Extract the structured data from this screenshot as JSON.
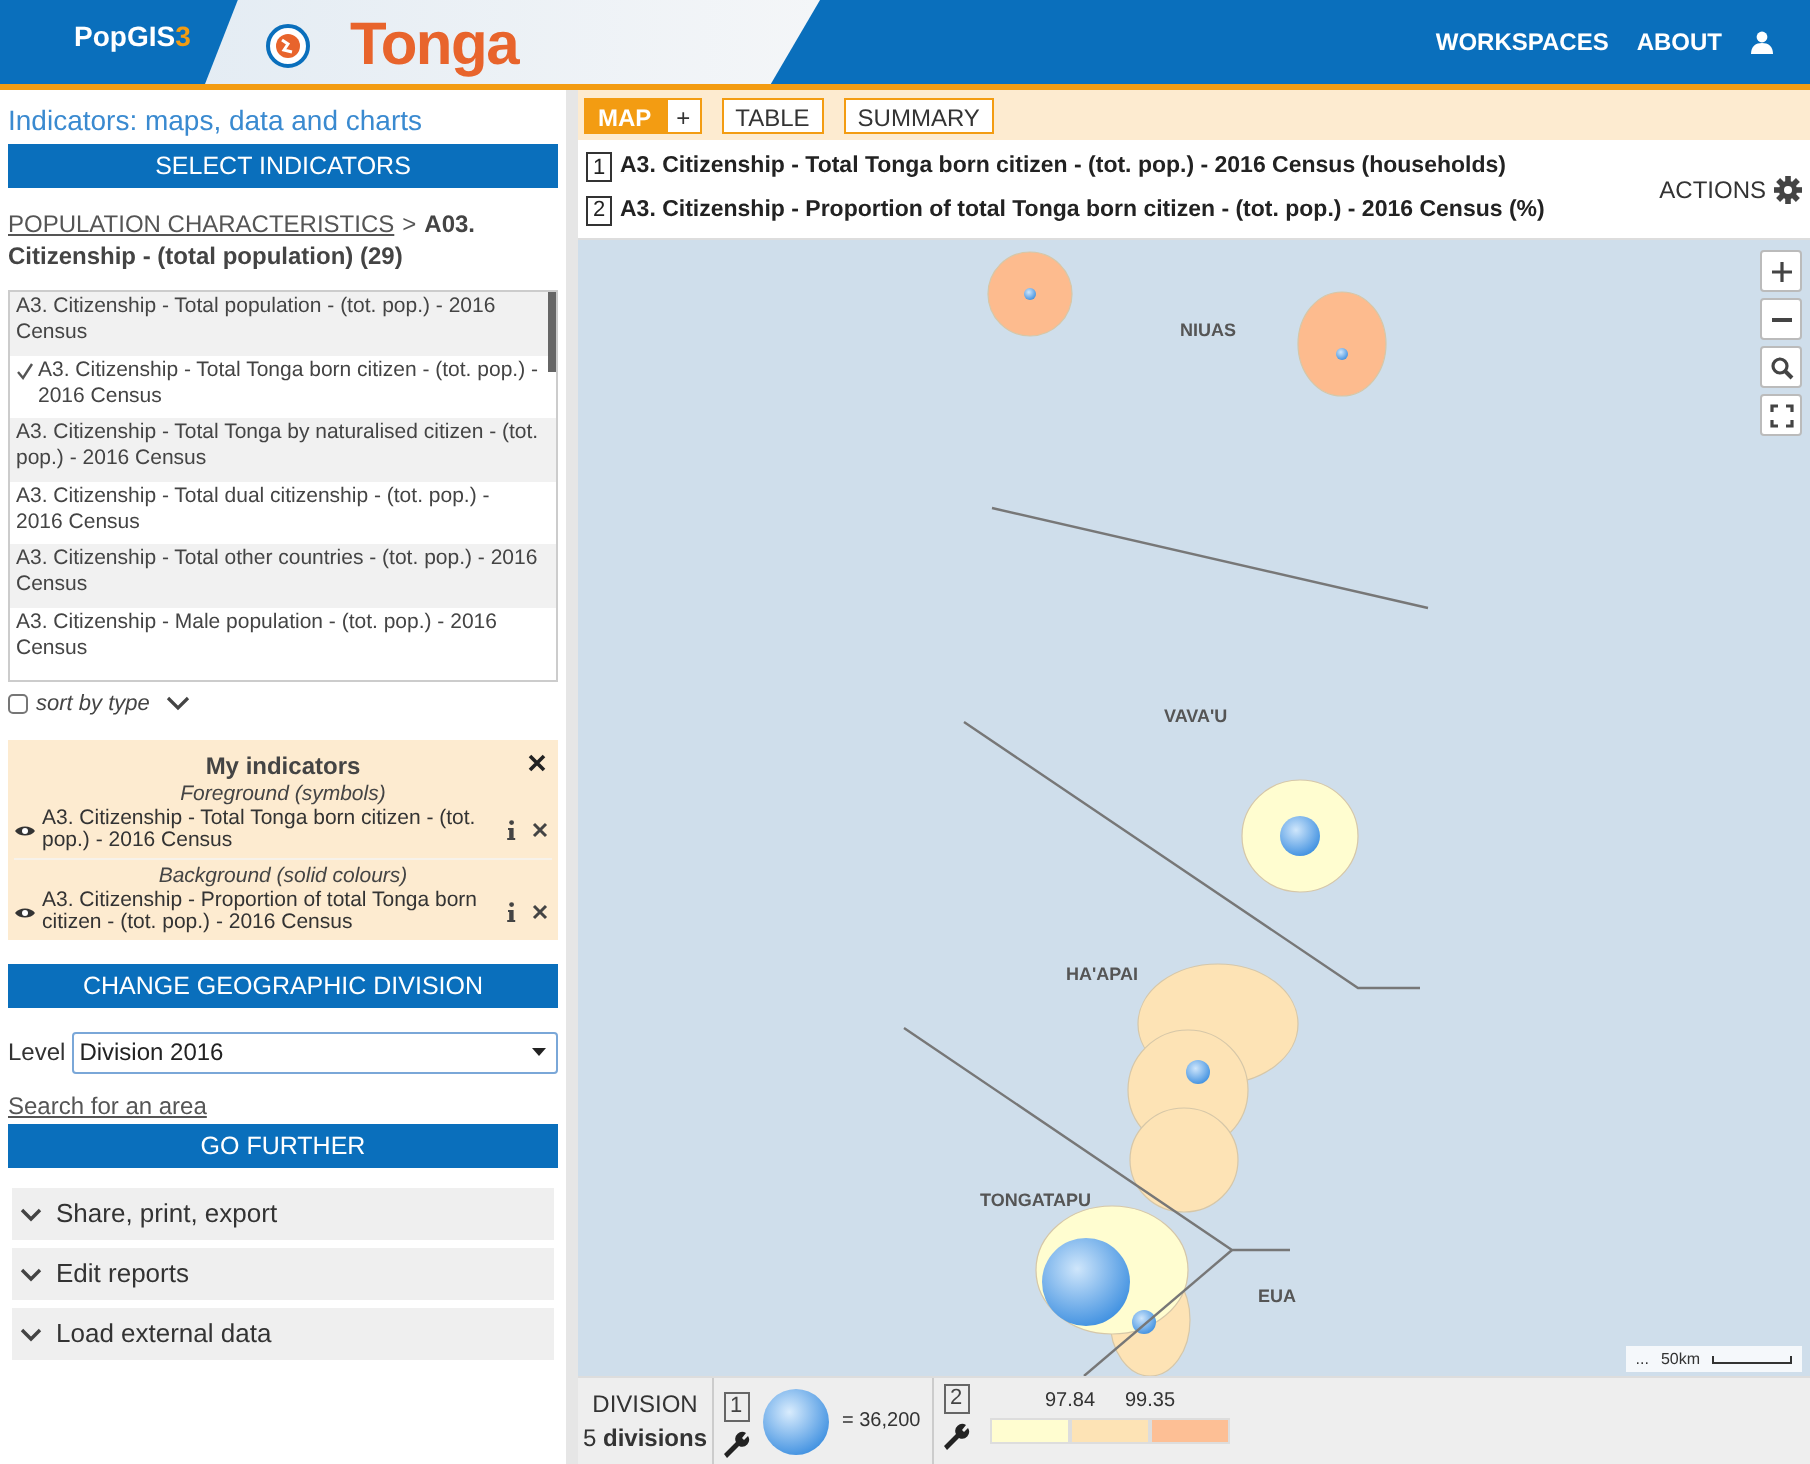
{
  "header": {
    "logo": "PopGIS",
    "logo_sup": "3",
    "country": "Tonga",
    "nav": [
      "WORKSPACES",
      "ABOUT"
    ]
  },
  "sidebar": {
    "title": "Indicators: maps, data and charts",
    "select_button": "SELECT INDICATORS",
    "breadcrumb": {
      "link": "POPULATION CHARACTERISTICS",
      "separator": ">",
      "current": "A03. Citizenship - (total population) (29)"
    },
    "indicators": [
      {
        "label": "A3. Citizenship - Total population - (tot. pop.) - 2016 Census",
        "selected": false
      },
      {
        "label": "A3. Citizenship - Total Tonga born citizen - (tot. pop.) - 2016 Census",
        "selected": true
      },
      {
        "label": "A3. Citizenship - Total Tonga by naturalised citizen - (tot. pop.) - 2016 Census",
        "selected": false
      },
      {
        "label": "A3. Citizenship - Total dual citizenship - (tot. pop.) - 2016 Census",
        "selected": false
      },
      {
        "label": "A3. Citizenship - Total other countries - (tot. pop.) - 2016 Census",
        "selected": false
      },
      {
        "label": "A3. Citizenship - Male population - (tot. pop.) - 2016 Census",
        "selected": false
      }
    ],
    "sort_by_type": {
      "label": "sort by type",
      "checked": false
    },
    "my_indicators": {
      "title": "My indicators",
      "groups": [
        {
          "heading": "Foreground (symbols)",
          "label": "A3. Citizenship - Total Tonga born citizen - (tot. pop.) - 2016 Census"
        },
        {
          "heading": "Background (solid colours)",
          "label": "A3. Citizenship - Proportion of total Tonga born citizen - (tot. pop.) - 2016 Census"
        }
      ]
    },
    "geo_button": "CHANGE GEOGRAPHIC DIVISION",
    "level": {
      "label": "Level",
      "value": "Division 2016"
    },
    "search_link": "Search for an area",
    "further_button": "GO FURTHER",
    "accordions": [
      "Share, print, export",
      "Edit reports",
      "Load external data"
    ]
  },
  "main": {
    "tabs": [
      {
        "label": "MAP",
        "selected": true
      },
      {
        "label": "TABLE",
        "selected": false
      },
      {
        "label": "SUMMARY",
        "selected": false
      }
    ],
    "add_button": "+",
    "titles": [
      {
        "number": "1",
        "text": "A3. Citizenship - Total Tonga born citizen - (tot. pop.) - 2016 Census (households)"
      },
      {
        "number": "2",
        "text": "A3. Citizenship - Proportion of total Tonga born citizen - (tot. pop.) - 2016 Census (%)"
      }
    ],
    "actions": "ACTIONS",
    "map": {
      "regions": [
        {
          "name": "NIUAS",
          "color": "#fdbb8e"
        },
        {
          "name": "VAVA'U",
          "color": "#fffdd0"
        },
        {
          "name": "HA'APAI",
          "color": "#fde3b5"
        },
        {
          "name": "TONGATAPU",
          "color": "#fffdd0"
        },
        {
          "name": "EUA",
          "color": "#fde3b5"
        }
      ],
      "scale": {
        "prefix": "...",
        "label": "50km"
      }
    },
    "legend": {
      "division_label": "DIVISION",
      "division_count": "5 **divisions**",
      "symbol": {
        "number": "1",
        "value": "= 36,200"
      },
      "choropleth": {
        "number": "2",
        "thresholds": [
          "97.84",
          "99.35"
        ],
        "classes": [
          {
            "color": "#fffdd0"
          },
          {
            "color": "#fde3b5"
          },
          {
            "color": "#fdbf95"
          }
        ]
      }
    }
  }
}
